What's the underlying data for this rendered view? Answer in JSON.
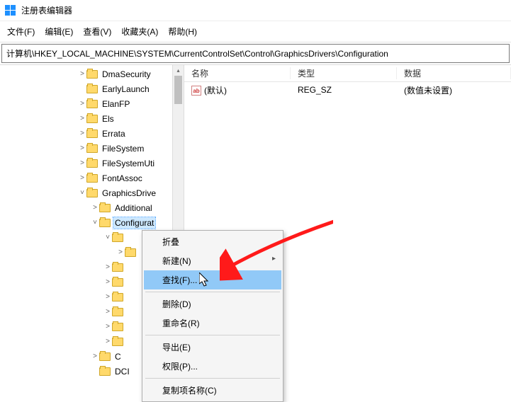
{
  "window": {
    "title": "注册表编辑器"
  },
  "menu": {
    "file": "文件(F)",
    "edit": "编辑(E)",
    "view": "查看(V)",
    "favorites": "收藏夹(A)",
    "help": "帮助(H)"
  },
  "path": "计算机\\HKEY_LOCAL_MACHINE\\SYSTEM\\CurrentControlSet\\Control\\GraphicsDrivers\\Configuration",
  "tree": {
    "items": [
      {
        "indent": 110,
        "chev": ">",
        "label": "DmaSecurity"
      },
      {
        "indent": 110,
        "chev": "",
        "label": "EarlyLaunch"
      },
      {
        "indent": 110,
        "chev": ">",
        "label": "ElanFP"
      },
      {
        "indent": 110,
        "chev": ">",
        "label": "Els"
      },
      {
        "indent": 110,
        "chev": ">",
        "label": "Errata"
      },
      {
        "indent": 110,
        "chev": ">",
        "label": "FileSystem"
      },
      {
        "indent": 110,
        "chev": ">",
        "label": "FileSystemUti"
      },
      {
        "indent": 110,
        "chev": ">",
        "label": "FontAssoc"
      },
      {
        "indent": 110,
        "chev": "v",
        "label": "GraphicsDrive"
      },
      {
        "indent": 128,
        "chev": ">",
        "label": "Additional"
      },
      {
        "indent": 128,
        "chev": "v",
        "label": "Configurat",
        "selected": true
      },
      {
        "indent": 146,
        "chev": "v",
        "label": ""
      },
      {
        "indent": 164,
        "chev": ">",
        "label": ""
      },
      {
        "indent": 146,
        "chev": ">",
        "label": ""
      },
      {
        "indent": 146,
        "chev": ">",
        "label": ""
      },
      {
        "indent": 146,
        "chev": ">",
        "label": ""
      },
      {
        "indent": 146,
        "chev": ">",
        "label": ""
      },
      {
        "indent": 146,
        "chev": ">",
        "label": ""
      },
      {
        "indent": 146,
        "chev": ">",
        "label": ""
      },
      {
        "indent": 128,
        "chev": ">",
        "label": "C"
      },
      {
        "indent": 128,
        "chev": "",
        "label": "DCI"
      }
    ]
  },
  "list": {
    "headers": {
      "name": "名称",
      "type": "类型",
      "data": "数据"
    },
    "rows": [
      {
        "name": "(默认)",
        "type": "REG_SZ",
        "data": "(数值未设置)"
      }
    ]
  },
  "context_menu": {
    "collapse": "折叠",
    "new": "新建(N)",
    "find": "查找(F)...",
    "delete": "删除(D)",
    "rename": "重命名(R)",
    "export": "导出(E)",
    "permissions": "权限(P)...",
    "copy_key_name": "复制项名称(C)"
  }
}
